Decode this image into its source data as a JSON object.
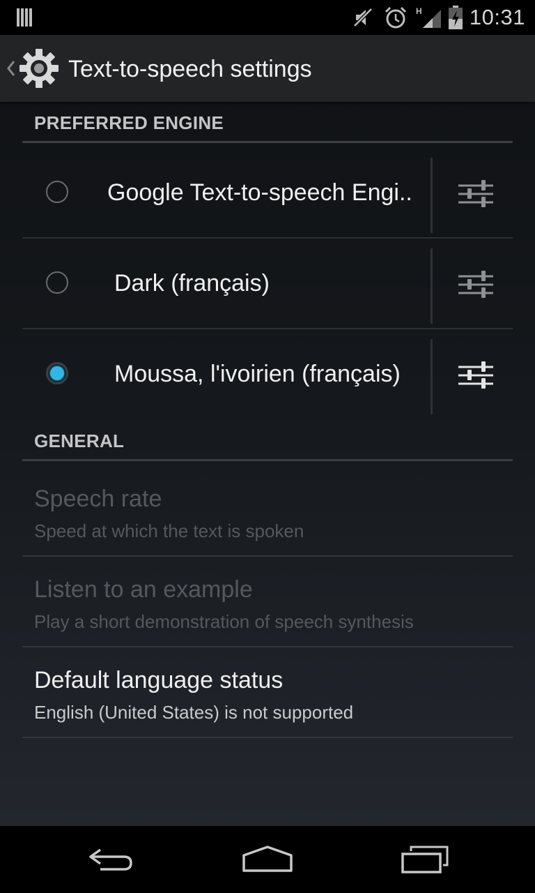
{
  "status_bar": {
    "time": "10:31",
    "icons": [
      "signal-indicator-icon",
      "mute-icon",
      "alarm-icon",
      "hspa-signal-icon",
      "battery-charging-icon"
    ],
    "network_type": "H"
  },
  "action_bar": {
    "title": "Text-to-speech settings",
    "icon": "gear-icon"
  },
  "preferred_engine": {
    "header": "PREFERRED ENGINE",
    "engines": [
      {
        "label": "Google Text-to-speech Engi..",
        "selected": false
      },
      {
        "label": "Dark (français)",
        "selected": false
      },
      {
        "label": "Moussa, l'ivoirien (français)",
        "selected": true
      }
    ]
  },
  "general": {
    "header": "GENERAL",
    "items": [
      {
        "title": "Speech rate",
        "summary": "Speed at which the text is spoken",
        "enabled": false
      },
      {
        "title": "Listen to an example",
        "summary": "Play a short demonstration of speech synthesis",
        "enabled": false
      },
      {
        "title": "Default language status",
        "summary": "English (United States) is not supported",
        "enabled": true
      }
    ]
  },
  "colors": {
    "accent": "#33b5e5",
    "background": "#15181c",
    "action_bar": "#222426"
  },
  "nav_bar": {
    "buttons": [
      "back-icon",
      "home-icon",
      "recent-apps-icon"
    ]
  }
}
